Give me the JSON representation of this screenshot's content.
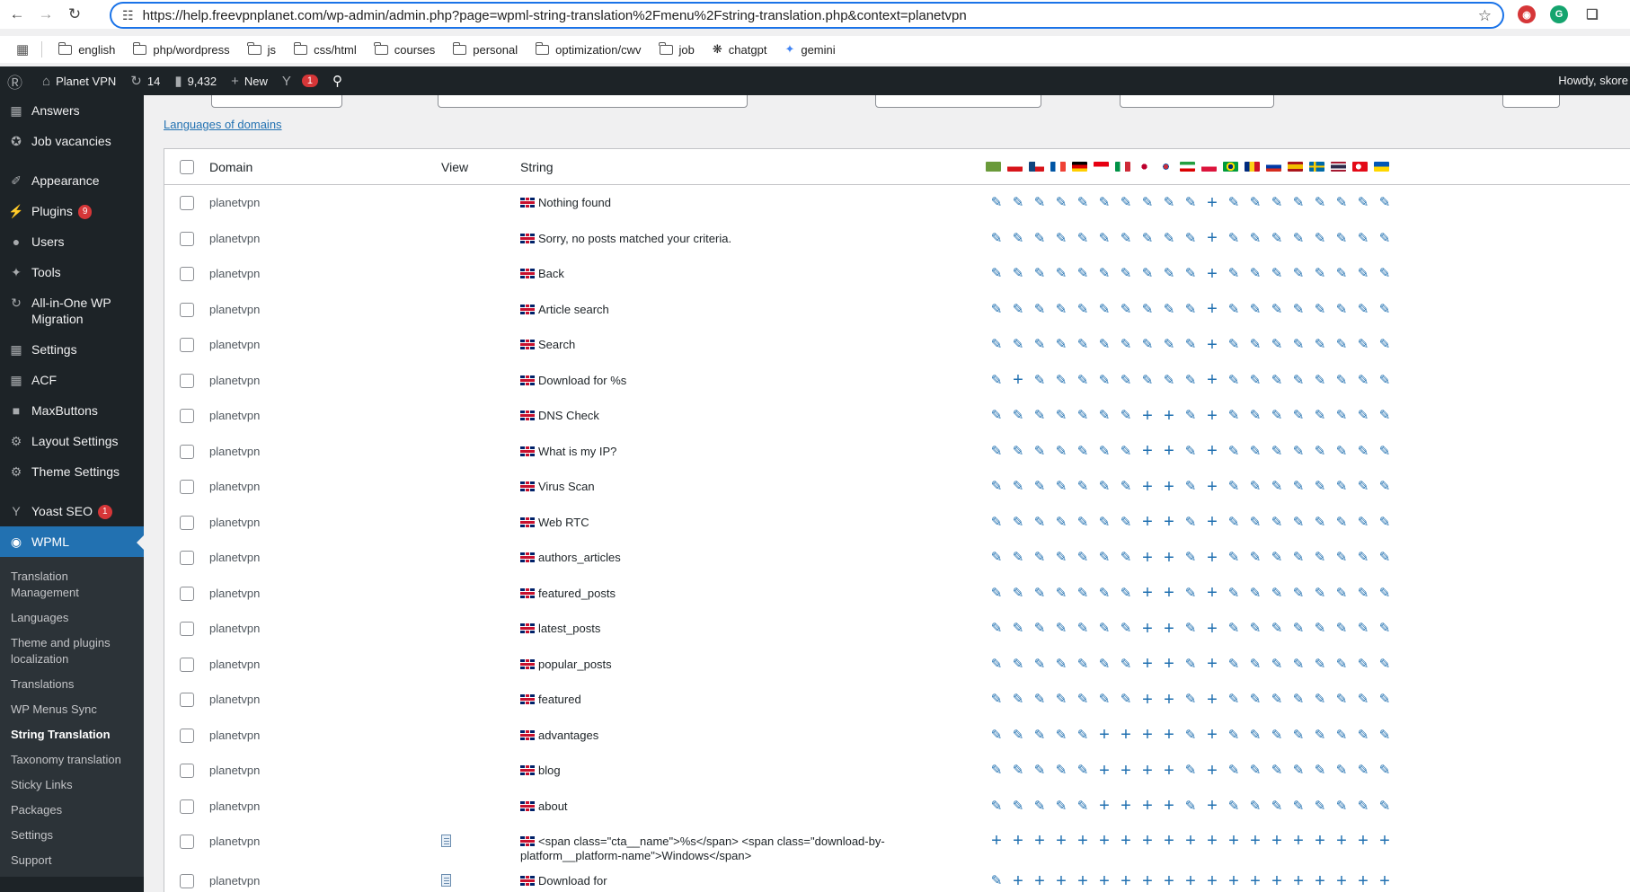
{
  "browser": {
    "url": "https://help.freevpnplanet.com/wp-admin/admin.php?page=wpml-string-translation%2Fmenu%2Fstring-translation.php&context=planetvpn",
    "bookmarks": [
      "english",
      "php/wordpress",
      "js",
      "css/html",
      "courses",
      "personal",
      "optimization/cwv",
      "job",
      "chatgpt",
      "gemini"
    ]
  },
  "adminbar": {
    "site_name": "Planet VPN",
    "updates": "14",
    "comments": "9,432",
    "new_label": "New",
    "yoast_count": "1",
    "howdy": "Howdy, skore"
  },
  "sidebar": {
    "items": [
      {
        "label": "Answers",
        "icon": "grid-icon"
      },
      {
        "label": "Job vacancies",
        "icon": "pin-icon"
      },
      {
        "label": "Appearance",
        "icon": "brush-icon"
      },
      {
        "label": "Plugins",
        "icon": "plug-icon",
        "count": "9"
      },
      {
        "label": "Users",
        "icon": "user-icon"
      },
      {
        "label": "Tools",
        "icon": "wrench-icon"
      },
      {
        "label": "All-in-One WP Migration",
        "icon": "migration-icon"
      },
      {
        "label": "Settings",
        "icon": "settings-icon"
      },
      {
        "label": "ACF",
        "icon": "acf-icon"
      },
      {
        "label": "MaxButtons",
        "icon": "maxbuttons-icon"
      },
      {
        "label": "Layout Settings",
        "icon": "gear-icon"
      },
      {
        "label": "Theme Settings",
        "icon": "gear-icon"
      },
      {
        "label": "Yoast SEO",
        "icon": "yoast-icon",
        "count": "1"
      },
      {
        "label": "WPML",
        "icon": "wpml-icon"
      }
    ],
    "submenu": [
      "Translation Management",
      "Languages",
      "Theme and plugins localization",
      "Translations",
      "WP Menus Sync",
      "String Translation",
      "Taxonomy translation",
      "Sticky Links",
      "Packages",
      "Settings",
      "Support"
    ],
    "current_sub": "String Translation"
  },
  "main": {
    "languages_of_domains_link": "Languages of domains",
    "columns": {
      "domain": "Domain",
      "view": "View",
      "string": "String"
    },
    "language_flags": [
      "ar",
      "cs",
      "cz",
      "fr",
      "de",
      "id",
      "it",
      "ja",
      "ko",
      "fa",
      "pl",
      "pt-br",
      "ro",
      "ru",
      "es",
      "sv",
      "th",
      "tr",
      "uk"
    ],
    "rows": [
      {
        "domain": "planetvpn",
        "string": "Nothing found",
        "view": false,
        "status": "EEEEEEEEEEAEEEEEEEE"
      },
      {
        "domain": "planetvpn",
        "string": "Sorry, no posts matched your criteria.",
        "view": false,
        "status": "EEEEEEEEEEAEEEEEEEE"
      },
      {
        "domain": "planetvpn",
        "string": "Back",
        "view": false,
        "status": "EEEEEEEEEEAEEEEEEEE"
      },
      {
        "domain": "planetvpn",
        "string": "Article search",
        "view": false,
        "status": "EEEEEEEEEEAEEEEEEEE"
      },
      {
        "domain": "planetvpn",
        "string": "Search",
        "view": false,
        "status": "EEEEEEEEEEAEEEEEEEE"
      },
      {
        "domain": "planetvpn",
        "string": "Download for %s",
        "view": false,
        "status": "EAEEEEEEEEAEEEEEEEE"
      },
      {
        "domain": "planetvpn",
        "string": "DNS Check",
        "view": false,
        "status": "EEEEEEEAAEAEEEEEEEE"
      },
      {
        "domain": "planetvpn",
        "string": "What is my IP?",
        "view": false,
        "status": "EEEEEEEAAEAEEEEEEEE"
      },
      {
        "domain": "planetvpn",
        "string": "Virus Scan",
        "view": false,
        "status": "EEEEEEEAAEAEEEEEEEE"
      },
      {
        "domain": "planetvpn",
        "string": "Web RTC",
        "view": false,
        "status": "EEEEEEEAAEAEEEEEEEE"
      },
      {
        "domain": "planetvpn",
        "string": "authors_articles",
        "view": false,
        "status": "EEEEEEEAAEAEEEEEEEE"
      },
      {
        "domain": "planetvpn",
        "string": "featured_posts",
        "view": false,
        "status": "EEEEEEEAAEAEEEEEEEE"
      },
      {
        "domain": "planetvpn",
        "string": "latest_posts",
        "view": false,
        "status": "EEEEEEEAAEAEEEEEEEE"
      },
      {
        "domain": "planetvpn",
        "string": "popular_posts",
        "view": false,
        "status": "EEEEEEEAAEAEEEEEEEE"
      },
      {
        "domain": "planetvpn",
        "string": "featured",
        "view": false,
        "status": "EEEEEEEAAEAEEEEEEEE"
      },
      {
        "domain": "planetvpn",
        "string": "advantages",
        "view": false,
        "status": "EEEEEAAAAEAEEEEEEEE"
      },
      {
        "domain": "planetvpn",
        "string": "blog",
        "view": false,
        "status": "EEEEEAAAAEAEEEEEEEE"
      },
      {
        "domain": "planetvpn",
        "string": "about",
        "view": false,
        "status": "EEEEEAAAAEAEEEEEEEE"
      },
      {
        "domain": "planetvpn",
        "string": "<span class=\"cta__name\">%s</span> <span class=\"download-by-platform__platform-name\">Windows</span>",
        "view": true,
        "status": "AAAAAAAAAAAAAAAAAAA"
      },
      {
        "domain": "planetvpn",
        "string": "Download for",
        "view": true,
        "status": "EAAAAAAAAAAAAAAAAAA"
      }
    ]
  }
}
